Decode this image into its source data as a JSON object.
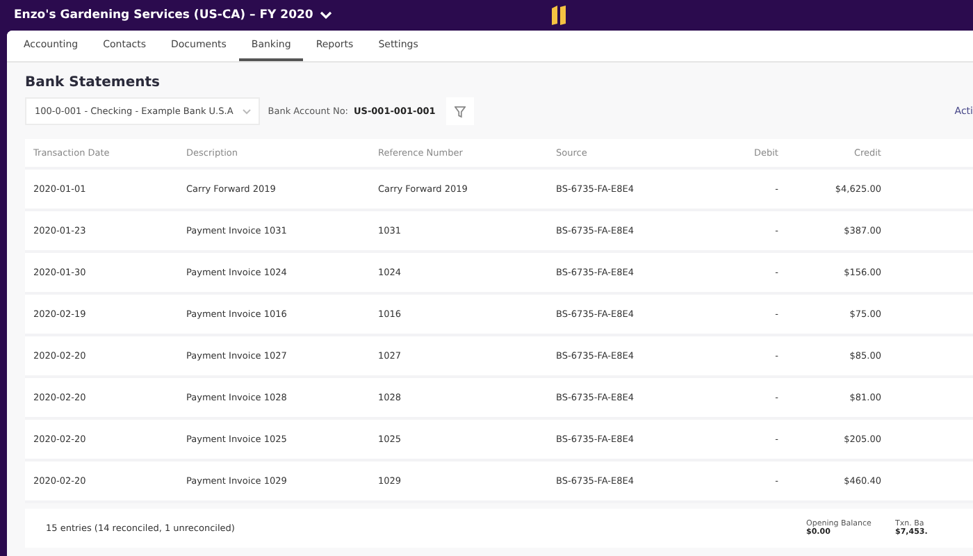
{
  "header": {
    "company": "Enzo's Gardening Services (US-CA) – FY 2020"
  },
  "tabs": [
    {
      "label": "Accounting",
      "selected": false
    },
    {
      "label": "Contacts",
      "selected": false
    },
    {
      "label": "Documents",
      "selected": false
    },
    {
      "label": "Banking",
      "selected": true
    },
    {
      "label": "Reports",
      "selected": false
    },
    {
      "label": "Settings",
      "selected": false
    }
  ],
  "page_title": "Bank Statements",
  "account_select": {
    "value": "100-0-001 - Checking - Example Bank U.S.A"
  },
  "bank_account": {
    "label": "Bank Account No:",
    "value": "US-001-001-001"
  },
  "actions_link": "Acti",
  "table": {
    "columns": [
      "Transaction Date",
      "Description",
      "Reference Number",
      "Source",
      "Debit",
      "Credit"
    ],
    "rows": [
      [
        "2020-01-01",
        "Carry Forward 2019",
        "Carry Forward 2019",
        "BS-6735-FA-E8E4",
        "-",
        "$4,625.00"
      ],
      [
        "2020-01-23",
        "Payment Invoice 1031",
        "1031",
        "BS-6735-FA-E8E4",
        "-",
        "$387.00"
      ],
      [
        "2020-01-30",
        "Payment Invoice 1024",
        "1024",
        "BS-6735-FA-E8E4",
        "-",
        "$156.00"
      ],
      [
        "2020-02-19",
        "Payment Invoice 1016",
        "1016",
        "BS-6735-FA-E8E4",
        "-",
        "$75.00"
      ],
      [
        "2020-02-20",
        "Payment Invoice 1027",
        "1027",
        "BS-6735-FA-E8E4",
        "-",
        "$85.00"
      ],
      [
        "2020-02-20",
        "Payment Invoice 1028",
        "1028",
        "BS-6735-FA-E8E4",
        "-",
        "$81.00"
      ],
      [
        "2020-02-20",
        "Payment Invoice 1025",
        "1025",
        "BS-6735-FA-E8E4",
        "-",
        "$205.00"
      ],
      [
        "2020-02-20",
        "Payment Invoice 1029",
        "1029",
        "BS-6735-FA-E8E4",
        "-",
        "$460.40"
      ]
    ]
  },
  "footer": {
    "summary": "15 entries (14 reconciled, 1 unreconciled)",
    "totals": [
      {
        "label": "Opening Balance",
        "value": "$0.00"
      },
      {
        "label": "Txn. Ba",
        "value": "$7,453."
      }
    ]
  }
}
